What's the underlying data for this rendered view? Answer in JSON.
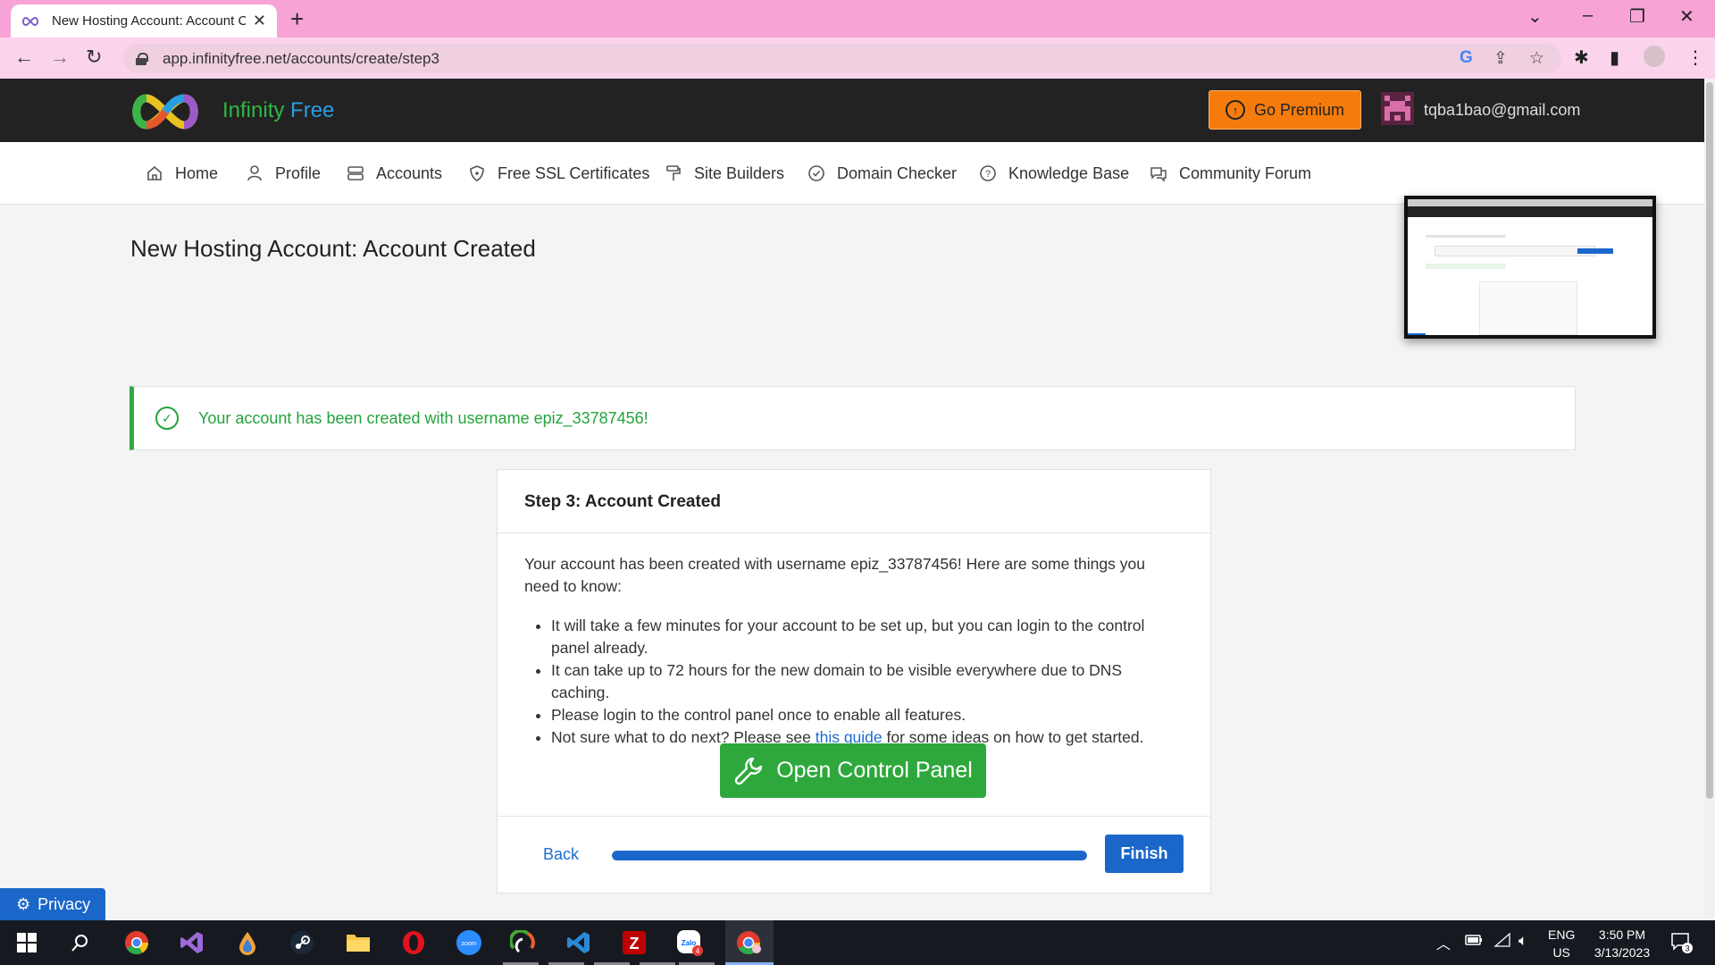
{
  "browser": {
    "tab_title": "New Hosting Account: Account C",
    "url": "app.infinityfree.net/accounts/create/step3"
  },
  "site": {
    "brand_first": "Infinity",
    "brand_second": " Free",
    "premium_label": "Go Premium",
    "user_email": "tqba1bao@gmail.com"
  },
  "nav": {
    "items": [
      {
        "label": "Home",
        "icon": "home-icon"
      },
      {
        "label": "Profile",
        "icon": "user-icon"
      },
      {
        "label": "Accounts",
        "icon": "server-icon"
      },
      {
        "label": "Free SSL Certificates",
        "icon": "shield-icon"
      },
      {
        "label": "Site Builders",
        "icon": "paint-roller-icon"
      },
      {
        "label": "Domain Checker",
        "icon": "check-circle-icon"
      },
      {
        "label": "Knowledge Base",
        "icon": "help-circle-icon"
      },
      {
        "label": "Community Forum",
        "icon": "chat-icon"
      }
    ]
  },
  "page": {
    "title": "New Hosting Account: Account Created",
    "alert": "Your account has been created with username epiz_33787456!"
  },
  "card": {
    "heading": "Step 3: Account Created",
    "intro": "Your account has been created with username epiz_33787456! Here are some things you need to know:",
    "bullets": [
      "It will take a few minutes for your account to be set up, but you can login to the control panel already.",
      "It can take up to 72 hours for the new domain to be visible everywhere due to DNS caching.",
      "Please login to the control panel once to enable all features."
    ],
    "last_bullet_before": "Not sure what to do next? Please see ",
    "last_bullet_link": "this guide",
    "last_bullet_after": " for some ideas on how to get started.",
    "cp_button": "Open Control Panel",
    "back_label": "Back",
    "progress": 1.0,
    "finish_label": "Finish"
  },
  "privacy_label": "Privacy",
  "taskbar": {
    "lang": "ENG",
    "region": "US",
    "time": "3:50 PM",
    "date": "3/13/2023",
    "notifications": "3",
    "zalo_badge": "4"
  },
  "colors": {
    "accent_green": "#2ea83c",
    "accent_blue": "#1a67c9",
    "premium_orange": "#f57c0c",
    "header_dark": "#222222",
    "tab_pink": "#f7a3d6"
  }
}
